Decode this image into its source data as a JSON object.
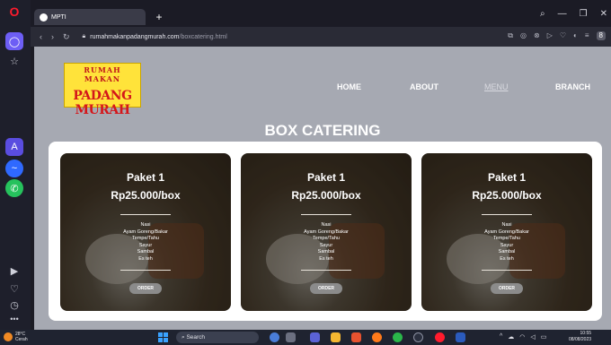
{
  "browser": {
    "tab_title": "MPTI",
    "url_domain": "rumahmakanpadangmurah.com",
    "url_path": "/boxcatering.html",
    "window_controls": [
      "⌕",
      "—",
      "❐",
      "✕"
    ]
  },
  "site": {
    "logo_top": "RUMAH MAKAN",
    "logo_bottom": "PADANG MURAH",
    "nav": [
      "HOME",
      "ABOUT",
      "MENU",
      "BRANCH"
    ],
    "active_nav": "MENU",
    "section_title": "BOX CATERING"
  },
  "cards": [
    {
      "title": "Paket 1",
      "price": "Rp25.000/box",
      "items": [
        "Nasi",
        "Ayam Goreng/Bakar",
        "Tempe/Tahu",
        "Sayur",
        "Sambal",
        "Es teh"
      ],
      "button": "ORDER"
    },
    {
      "title": "Paket 1",
      "price": "Rp25.000/box",
      "items": [
        "Nasi",
        "Ayam Goreng/Bakar",
        "Tempe/Tahu",
        "Sayur",
        "Sambal",
        "Es teh"
      ],
      "button": "ORDER"
    },
    {
      "title": "Paket 1",
      "price": "Rp25.000/box",
      "items": [
        "Nasi",
        "Ayam Goreng/Bakar",
        "Tempe/Tahu",
        "Sayur",
        "Sambal",
        "Es teh"
      ],
      "button": "ORDER"
    }
  ],
  "taskbar": {
    "weather_temp": "28°C",
    "weather_desc": "Cerah",
    "search_label": "Search",
    "time": "10:55",
    "date": "08/08/2023"
  },
  "colors": {
    "page_bg": "#a6a9b2",
    "logo_yellow": "#ffe33a",
    "logo_red": "#d4161a",
    "opera_red": "#ff1b2d",
    "sidebar_accent": "#6d5ef5"
  }
}
